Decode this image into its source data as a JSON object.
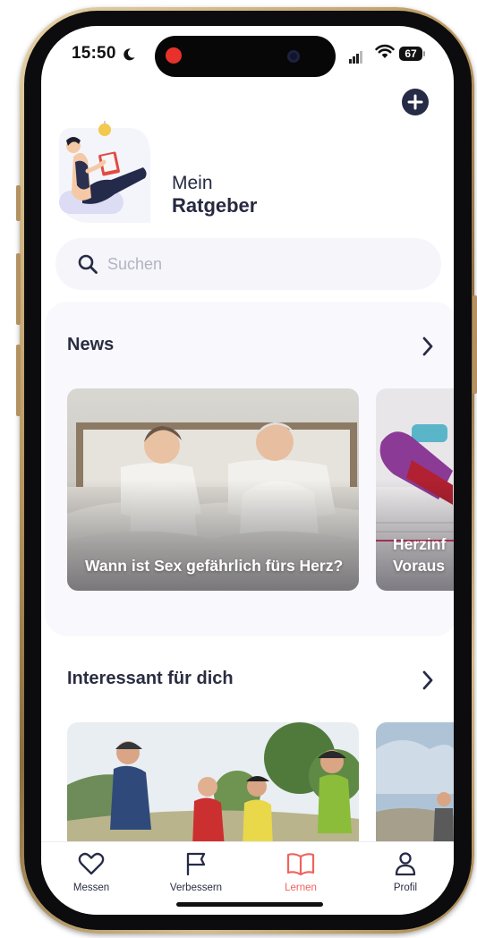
{
  "status_bar": {
    "time": "15:50",
    "battery": "67"
  },
  "header": {
    "subtitle": "Mein",
    "title": "Ratgeber"
  },
  "search": {
    "placeholder": "Suchen",
    "value": ""
  },
  "sections": {
    "news": {
      "title": "News",
      "cards": [
        {
          "title": "Wann ist Sex gefährlich fürs Herz?"
        },
        {
          "title": "Herzinf\nVoraus"
        }
      ]
    },
    "interesting": {
      "title": "Interessant für dich"
    }
  },
  "tabbar": {
    "items": [
      {
        "label": "Messen",
        "icon": "heart-icon"
      },
      {
        "label": "Verbessern",
        "icon": "flag-icon"
      },
      {
        "label": "Lernen",
        "icon": "book-icon",
        "active": true
      },
      {
        "label": "Profil",
        "icon": "person-icon"
      }
    ]
  },
  "colors": {
    "accent": "#f0625f",
    "dark": "#262b46",
    "panel": "#f8f8fd"
  }
}
